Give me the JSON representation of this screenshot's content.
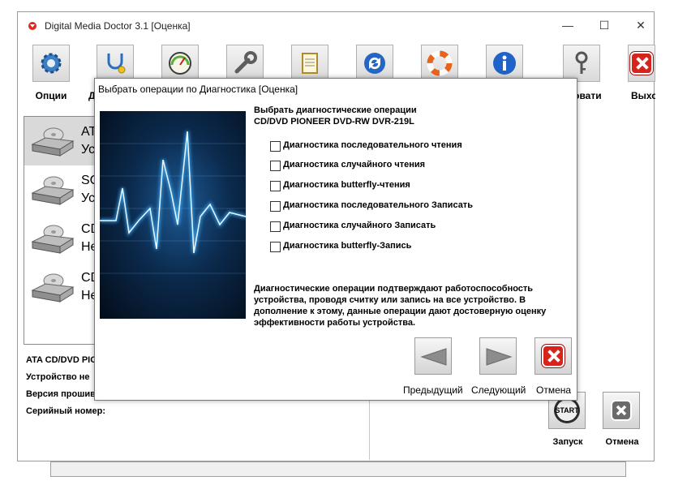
{
  "window": {
    "title": "Digital Media Doctor 3.1 [Оценка]",
    "minimize": "—",
    "maximize": "☐",
    "close": "✕"
  },
  "toolbar": [
    {
      "label": "Опции",
      "icon": "gear-icon"
    },
    {
      "label": "Ди",
      "icon": "stethoscope-icon"
    },
    {
      "label": "",
      "icon": "gauge-icon"
    },
    {
      "label": "",
      "icon": "wrench-icon"
    },
    {
      "label": "",
      "icon": "report-icon"
    },
    {
      "label": "",
      "icon": "refresh-icon"
    },
    {
      "label": "",
      "icon": "lifebuoy-icon"
    },
    {
      "label": "",
      "icon": "info-icon"
    },
    {
      "label": "ировати",
      "icon": "key-icon"
    },
    {
      "label": "Выхо",
      "icon": "exit-icon"
    }
  ],
  "devices": [
    {
      "name": "ATA",
      "status": "Ус",
      "selected": true
    },
    {
      "name": "SC",
      "status": "Ус",
      "selected": false
    },
    {
      "name": "CD",
      "status": "Не",
      "selected": false
    },
    {
      "name": "CD",
      "status": "Не",
      "selected": false
    }
  ],
  "info": {
    "model": "ATA CD/DVD PIO",
    "device": "Устройство не",
    "firmware": "Версия прошив",
    "serial": "Серийный номер:"
  },
  "main_buttons": {
    "start_glyph": "START",
    "start_label": "Запуск",
    "cancel_label": "Отмена"
  },
  "dialog": {
    "title": "Выбрать операции по Диагностика [Оценка]",
    "heading": "Выбрать диагностические операции",
    "device": "CD/DVD PIONEER DVD-RW  DVR-219L",
    "options": [
      {
        "label": "Диагностика последовательного чтения",
        "checked": false
      },
      {
        "label": "Диагностика случайного чтения",
        "checked": false
      },
      {
        "label": "Диагностика butterfly-чтения",
        "checked": false
      },
      {
        "label": "Диагностика последовательного Записать",
        "checked": false
      },
      {
        "label": "Диагностика случайного Записать",
        "checked": false
      },
      {
        "label": "Диагностика butterfly-Запись",
        "checked": false
      }
    ],
    "description": "Диагностические операции подтверждают работоспособность устройства, проводя считку или запись на все устройство. В дополнение к этому, данные операции дают достоверную оценку эффективности работы устройства.",
    "prev_label": "Предыдущий",
    "next_label": "Следующий",
    "cancel_label": "Отмена"
  },
  "colors": {
    "accent_red": "#d8221c",
    "selection": "#d9d9d9",
    "hero_blue": "#1d5a95"
  }
}
